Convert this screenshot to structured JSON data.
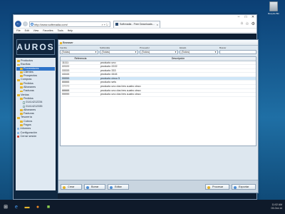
{
  "desktop": {
    "recycle_label": "Recycle Bin"
  },
  "browser": {
    "url": "http://www.softreadia.com/",
    "tab_title": "Softreadia - Free Downloads...",
    "menu": [
      "File",
      "Edit",
      "View",
      "Favorites",
      "Tools",
      "Help"
    ]
  },
  "app": {
    "logo": "AUROS",
    "tree": [
      {
        "label": "Productos",
        "icon": "folder"
      },
      {
        "label": "Escritas",
        "icon": "folder"
      },
      {
        "label": "Proveedores",
        "icon": "folder",
        "selected": true
      },
      {
        "label": "Clientes",
        "icon": "folder"
      },
      {
        "label": "Prospectos",
        "icon": "folder"
      },
      {
        "label": "Compras",
        "icon": "folder"
      },
      {
        "label": "Pedidos",
        "icon": "folder"
      },
      {
        "label": "Albaranes",
        "icon": "folder"
      },
      {
        "label": "Facturas",
        "icon": "folder"
      },
      {
        "label": "Ventas",
        "icon": "folder"
      },
      {
        "label": "Pedidos",
        "icon": "folder"
      },
      {
        "label": "01414212234",
        "icon": "doc"
      },
      {
        "label": "01414212335",
        "icon": "doc"
      },
      {
        "label": "Albaranes",
        "icon": "folder"
      },
      {
        "label": "Facturas",
        "icon": "folder"
      },
      {
        "label": "Tesorería",
        "icon": "folder"
      },
      {
        "label": "Cobros",
        "icon": "folder"
      },
      {
        "label": "Pagos",
        "icon": "folder"
      },
      {
        "label": "Informes",
        "icon": "dot"
      },
      {
        "label": "Configuración",
        "icon": "dot"
      },
      {
        "label": "Cerrar sesión",
        "icon": "red"
      }
    ],
    "panel_title": "Browser",
    "filters": [
      {
        "label": "Familia",
        "value": "(Todas)"
      },
      {
        "label": "Subfamilia",
        "value": "(Todas)"
      },
      {
        "label": "Proveedor",
        "value": "(Todos)"
      },
      {
        "label": "Estado",
        "value": "(Todos)"
      },
      {
        "label": "Buscar",
        "value": ""
      }
    ],
    "columns": [
      "Referencia",
      "Descripción"
    ],
    "rows": [
      [
        "11111",
        "producto uno"
      ],
      [
        "22222",
        "producto 2222"
      ],
      [
        "33333",
        "producto 333"
      ],
      [
        "44444",
        "producto 4444"
      ],
      [
        "55555",
        "producto cinco 5"
      ],
      [
        "66666",
        "producto seis"
      ],
      [
        "77777",
        "producto uno dos tres cuatro cinco"
      ],
      [
        "88888",
        "producto uno dos tres cuatro cinco"
      ],
      [
        "99999",
        "producto uno dos tres cuatro cinco"
      ]
    ],
    "highlighted_row": 4,
    "buttons": {
      "create": "Crear",
      "delete": "Borrar",
      "edit": "Editar",
      "process": "Procesar",
      "export": "Exportar"
    }
  },
  "taskbar": {
    "time": "11:02 AM",
    "date": "03-Oct-14"
  }
}
